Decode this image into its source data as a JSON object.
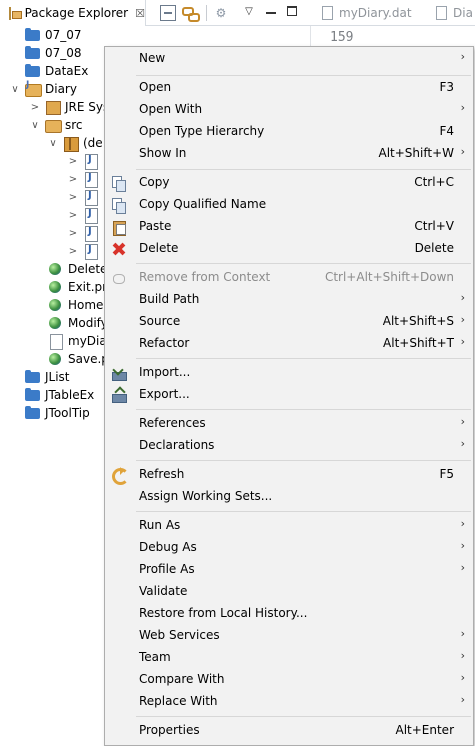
{
  "view_tab": {
    "title": "Package Explorer",
    "close": "☒"
  },
  "toolbar": {
    "focus_icon": "⚙",
    "menu_icon": "▽"
  },
  "editor_tabs": [
    {
      "label": "myDiary.dat"
    },
    {
      "label": "Dia"
    }
  ],
  "editor": {
    "line_number": "159"
  },
  "tree": [
    {
      "twist": "",
      "icon": "folder",
      "label": "07_07"
    },
    {
      "twist": "",
      "icon": "folder",
      "label": "07_08"
    },
    {
      "twist": "",
      "icon": "folder",
      "label": "DataEx"
    },
    {
      "twist": "∨",
      "icon": "project",
      "label": "Diary"
    },
    {
      "twist": ">",
      "icon": "lib",
      "label": "JRE Sys"
    },
    {
      "twist": "∨",
      "icon": "srcfolder",
      "label": "src"
    },
    {
      "twist": "∨",
      "icon": "pkg",
      "label": "(de"
    },
    {
      "twist": ">",
      "icon": "java",
      "label": ""
    },
    {
      "twist": ">",
      "icon": "java",
      "label": ""
    },
    {
      "twist": ">",
      "icon": "java",
      "label": ""
    },
    {
      "twist": ">",
      "icon": "java",
      "label": ""
    },
    {
      "twist": ">",
      "icon": "java",
      "label": ""
    },
    {
      "twist": ">",
      "icon": "java",
      "label": ""
    },
    {
      "twist": "",
      "icon": "globe",
      "label": "Delete."
    },
    {
      "twist": "",
      "icon": "globe",
      "label": "Exit.pn"
    },
    {
      "twist": "",
      "icon": "globe",
      "label": "Home."
    },
    {
      "twist": "",
      "icon": "globe",
      "label": "Modify"
    },
    {
      "twist": "",
      "icon": "doc",
      "label": "myDia"
    },
    {
      "twist": "",
      "icon": "globe",
      "label": "Save.p"
    },
    {
      "twist": "",
      "icon": "folder",
      "label": "JList"
    },
    {
      "twist": "",
      "icon": "folder",
      "label": "JTableEx"
    },
    {
      "twist": "",
      "icon": "folder",
      "label": "JToolTip"
    }
  ],
  "menu": {
    "new": {
      "label": "New",
      "arrow": "›"
    },
    "open": {
      "label": "Open",
      "shortcut": "F3"
    },
    "open_with": {
      "label": "Open With",
      "arrow": "›"
    },
    "open_type_hierarchy": {
      "label": "Open Type Hierarchy",
      "shortcut": "F4"
    },
    "show_in": {
      "label": "Show In",
      "shortcut": "Alt+Shift+W",
      "arrow": "›"
    },
    "copy": {
      "label": "Copy",
      "shortcut": "Ctrl+C"
    },
    "copy_qualified_name": {
      "label": "Copy Qualified Name"
    },
    "paste": {
      "label": "Paste",
      "shortcut": "Ctrl+V"
    },
    "delete": {
      "label": "Delete",
      "shortcut": "Delete"
    },
    "remove_from_context": {
      "label": "Remove from Context",
      "shortcut": "Ctrl+Alt+Shift+Down"
    },
    "build_path": {
      "label": "Build Path",
      "arrow": "›"
    },
    "source": {
      "label": "Source",
      "shortcut": "Alt+Shift+S",
      "arrow": "›"
    },
    "refactor": {
      "label": "Refactor",
      "shortcut": "Alt+Shift+T",
      "arrow": "›"
    },
    "import": {
      "label": "Import..."
    },
    "export": {
      "label": "Export..."
    },
    "references": {
      "label": "References",
      "arrow": "›"
    },
    "declarations": {
      "label": "Declarations",
      "arrow": "›"
    },
    "refresh": {
      "label": "Refresh",
      "shortcut": "F5"
    },
    "assign_working_sets": {
      "label": "Assign Working Sets..."
    },
    "run_as": {
      "label": "Run As",
      "arrow": "›"
    },
    "debug_as": {
      "label": "Debug As",
      "arrow": "›"
    },
    "profile_as": {
      "label": "Profile As",
      "arrow": "›"
    },
    "validate": {
      "label": "Validate"
    },
    "restore_local_history": {
      "label": "Restore from Local History..."
    },
    "web_services": {
      "label": "Web Services",
      "arrow": "›"
    },
    "team": {
      "label": "Team",
      "arrow": "›"
    },
    "compare_with": {
      "label": "Compare With",
      "arrow": "›"
    },
    "replace_with": {
      "label": "Replace With",
      "arrow": "›"
    },
    "properties": {
      "label": "Properties",
      "shortcut": "Alt+Enter"
    }
  }
}
